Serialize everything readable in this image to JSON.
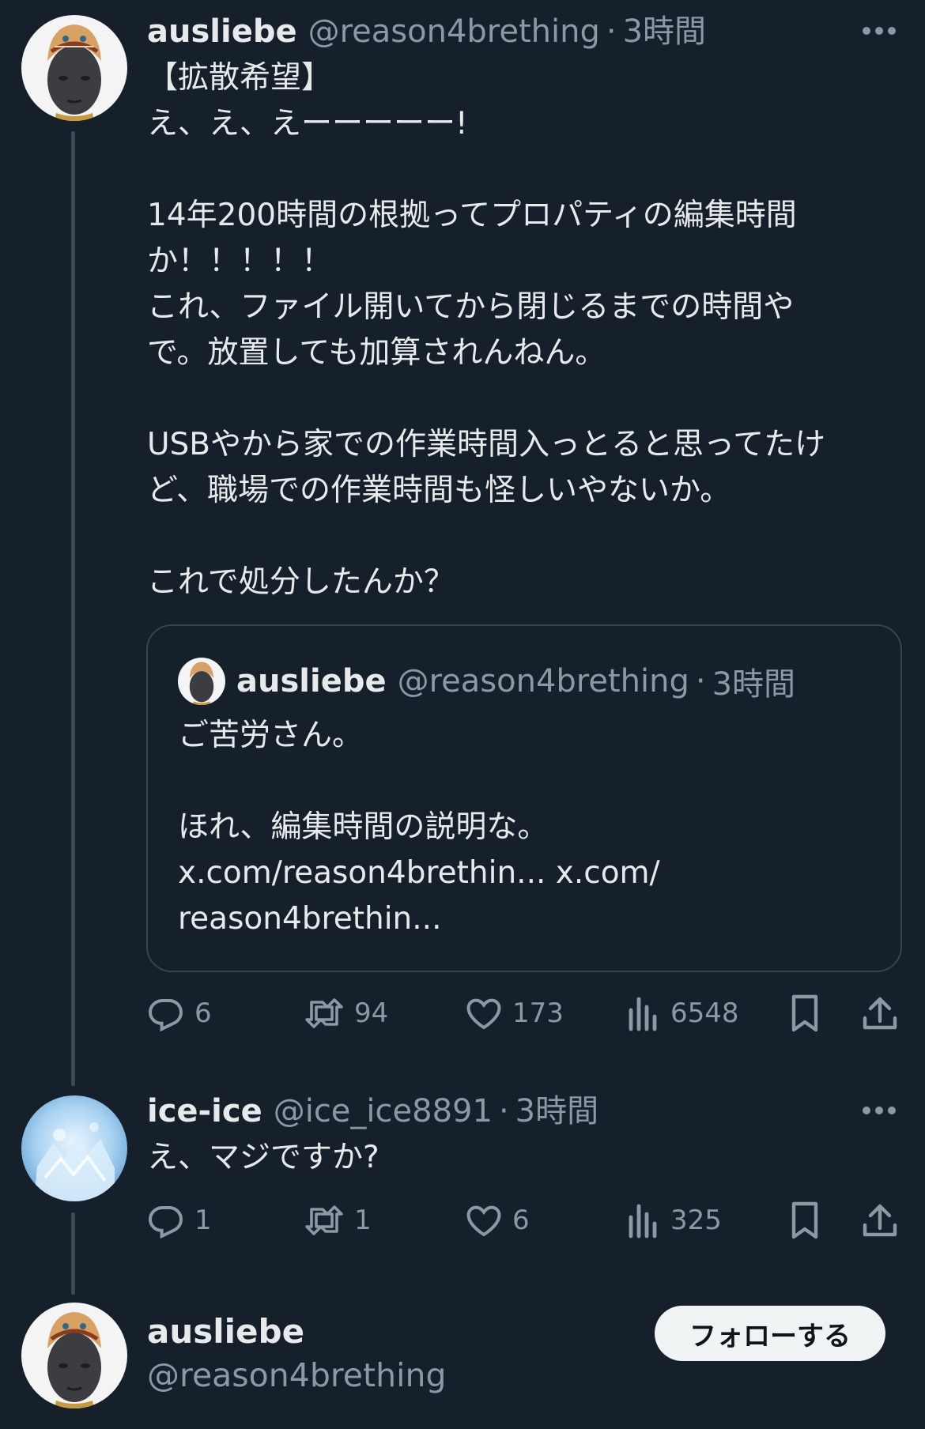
{
  "thread": {
    "post1": {
      "name": "ausliebe",
      "handle": "@reason4brething",
      "sep": "·",
      "time": "3時間",
      "more_icon": "more-icon",
      "lines": [
        "【拡散希望】",
        "え、え、えーーーーー!",
        "",
        "14年200時間の根拠ってプロパティの編集時間",
        "か！！！！！",
        "これ、ファイル開いてから閉じるまでの時間や",
        "で。放置しても加算されんねん。",
        "",
        "USBやから家での作業時間入っとると思ってたけ",
        "ど、職場での作業時間も怪しいやないか。",
        "",
        "これで処分したんか？"
      ],
      "quote": {
        "name": "ausliebe",
        "handle": "@reason4brething",
        "sep": "·",
        "time": "3時間",
        "lines": [
          "ご苦労さん。",
          "",
          "ほれ、編集時間の説明な。",
          "x.com/reason4brethin... x.com/",
          "reason4brethin..."
        ]
      },
      "actions": {
        "replies": "6",
        "reposts": "94",
        "likes": "173",
        "views": "6548"
      }
    },
    "post2": {
      "name": "ice-ice",
      "handle": "@ice_ice8891",
      "sep": "·",
      "time": "3時間",
      "text": "え、マジですか?",
      "actions": {
        "replies": "1",
        "reposts": "1",
        "likes": "6",
        "views": "325"
      }
    },
    "profile": {
      "name": "ausliebe",
      "handle": "@reason4brething",
      "follow_label": "フォローする"
    }
  },
  "colors": {
    "background": "#15202b",
    "text": "#e7e9ea",
    "muted": "#8b98a5",
    "border": "#38444d",
    "thread_line": "#3d4a56"
  }
}
